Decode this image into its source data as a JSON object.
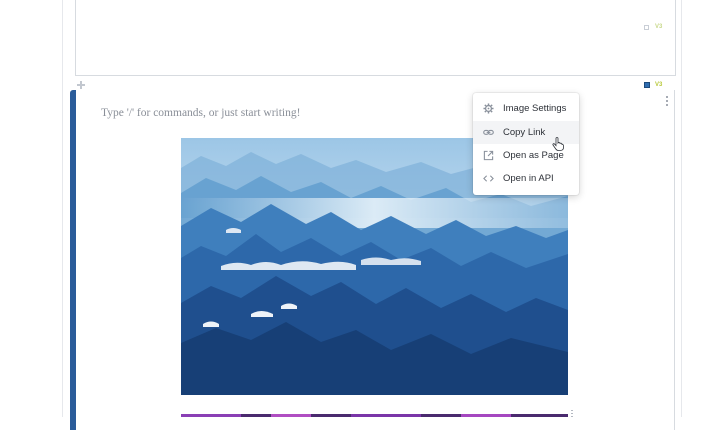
{
  "editor": {
    "placeholder": "Type '/' for commands, or just start writing!",
    "block_version_label": "V3",
    "prev_block_version_label": "V3"
  },
  "context_menu": {
    "items": [
      {
        "label": "Image Settings",
        "icon": "gear-icon"
      },
      {
        "label": "Copy Link",
        "icon": "link-icon"
      },
      {
        "label": "Open as Page",
        "icon": "open-external-icon"
      },
      {
        "label": "Open in API",
        "icon": "code-icon"
      }
    ],
    "hovered_item": "Copy Link"
  },
  "image": {
    "subject": "blue layered mountain ridges with low clouds"
  },
  "colors": {
    "active_bar": "#2a5c9a",
    "sky": "#cfe3f3",
    "mountain_dark": "#1f4f8e",
    "menu_text": "#2d3138",
    "next_image_accent": "#8a3fb5"
  }
}
